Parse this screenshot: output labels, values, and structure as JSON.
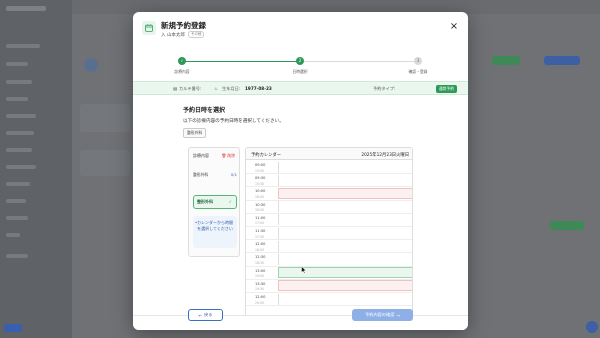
{
  "modal": {
    "title": "新規予約登録",
    "patient_name": "入 山本太郎",
    "patient_tag": "その他",
    "close_glyph": "×"
  },
  "steps": [
    {
      "label": "診療内容",
      "number": "1",
      "state": "done"
    },
    {
      "label": "日時選択",
      "number": "2",
      "state": "active"
    },
    {
      "label": "確認・登録",
      "number": "3",
      "state": "todo"
    }
  ],
  "info": {
    "karte_label": "カルテ番号:",
    "karte_value": "",
    "birth_label": "生年月日:",
    "birth_value": "1977-08-23",
    "type_label": "予約タイプ:",
    "type_value": "通常予約"
  },
  "section": {
    "title": "予約日時を選択",
    "description": "以下の診療内容の予約日時を選択してください。",
    "chip": "整形外科"
  },
  "dept": {
    "header": "診療内容",
    "delete_label": "削除",
    "row_label": "整形外科",
    "row_count": "0/1",
    "selected_label": "整形外科",
    "note": "カレンダーから時間を選択してください"
  },
  "calendar": {
    "header_left": "予約カレンダー",
    "header_right": "2025年12月23日火曜日",
    "slots": [
      {
        "time": "09:00",
        "sub": "15:00",
        "status": "normal"
      },
      {
        "time": "09:30",
        "sub": "15:30",
        "status": "normal"
      },
      {
        "time": "10:00",
        "sub": "16:00",
        "status": "booked"
      },
      {
        "time": "10:30",
        "sub": "16:30",
        "status": "normal"
      },
      {
        "time": "11:00",
        "sub": "17:00",
        "status": "normal"
      },
      {
        "time": "11:30",
        "sub": "17:30",
        "status": "normal"
      },
      {
        "time": "12:00",
        "sub": "18:00",
        "status": "normal"
      },
      {
        "time": "12:30",
        "sub": "18:30",
        "status": "normal"
      },
      {
        "time": "13:00",
        "sub": "19:00",
        "status": "available"
      },
      {
        "time": "13:30",
        "sub": "19:30",
        "status": "booked"
      },
      {
        "time": "12:00",
        "sub": "20:00",
        "status": "normal"
      }
    ]
  },
  "footer": {
    "back_label": "戻る",
    "back_arrow": "←",
    "next_label": "予約内容の確認",
    "next_arrow": "→"
  },
  "colors": {
    "accent": "#2f9a57",
    "primary": "#3a6fc7",
    "booked_bg": "#fdf0f0",
    "booked_border": "#f0c2c2",
    "available_bg": "#eaf7ee",
    "available_border": "#9fd4b1"
  }
}
